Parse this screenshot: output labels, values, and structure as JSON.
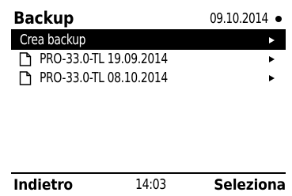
{
  "header": {
    "title": "Backup",
    "date": "09.10.2014",
    "status_icon": "filled-circle-indicator"
  },
  "menu": {
    "items": [
      {
        "label": "Crea backup",
        "icon": "",
        "selected": true,
        "arrow_icon": "right-triangle-icon"
      },
      {
        "label": "PRO-33.0-TL 19.09.2014",
        "icon": "file-icon",
        "selected": false,
        "arrow_icon": "right-triangle-icon"
      },
      {
        "label": "PRO-33.0-TL 08.10.2014",
        "icon": "file-icon",
        "selected": false,
        "arrow_icon": "right-triangle-icon"
      }
    ]
  },
  "footer": {
    "left_label": "Indietro",
    "time": "14:03",
    "right_label": "Seleziona"
  },
  "colors": {
    "background": "#ffffff",
    "foreground": "#000000",
    "selection_background": "#000000",
    "selection_foreground": "#ffffff"
  }
}
